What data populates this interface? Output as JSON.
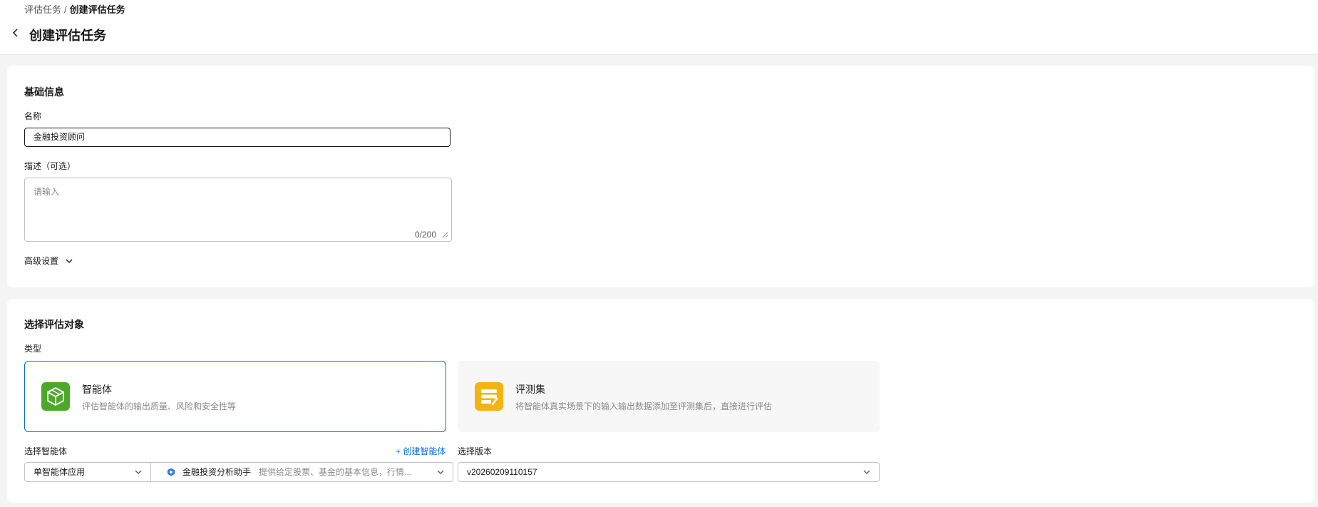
{
  "breadcrumb": {
    "parent": "评估任务",
    "separator": "/",
    "current": "创建评估任务"
  },
  "page_title": "创建评估任务",
  "basic": {
    "title": "基础信息",
    "name_label": "名称",
    "name_value": "金融投资顾问",
    "desc_label": "描述（可选）",
    "desc_placeholder": "请输入",
    "desc_counter": "0/200",
    "advanced_label": "高级设置"
  },
  "target": {
    "title": "选择评估对象",
    "type_label": "类型",
    "types": [
      {
        "name": "智能体",
        "desc": "评估智能体的输出质量、风险和安全性等",
        "icon": "cube-icon",
        "color": "#4ca82a",
        "selected": true
      },
      {
        "name": "评测集",
        "desc": "将智能体真实场景下的输入输出数据添加至评测集后，直接进行评估",
        "icon": "dataset-icon",
        "color": "#f5b312",
        "selected": false
      }
    ],
    "agent_label": "选择智能体",
    "create_agent_link": "+ 创建智能体",
    "app_type_value": "单智能体应用",
    "agent_name": "金融投资分析助手",
    "agent_desc": "提供给定股票、基金的基本信息，行情...",
    "version_label": "选择版本",
    "version_value": "v20260209110157"
  },
  "colors": {
    "primary": "#0c6bd6",
    "background": "#f4f4f4"
  }
}
